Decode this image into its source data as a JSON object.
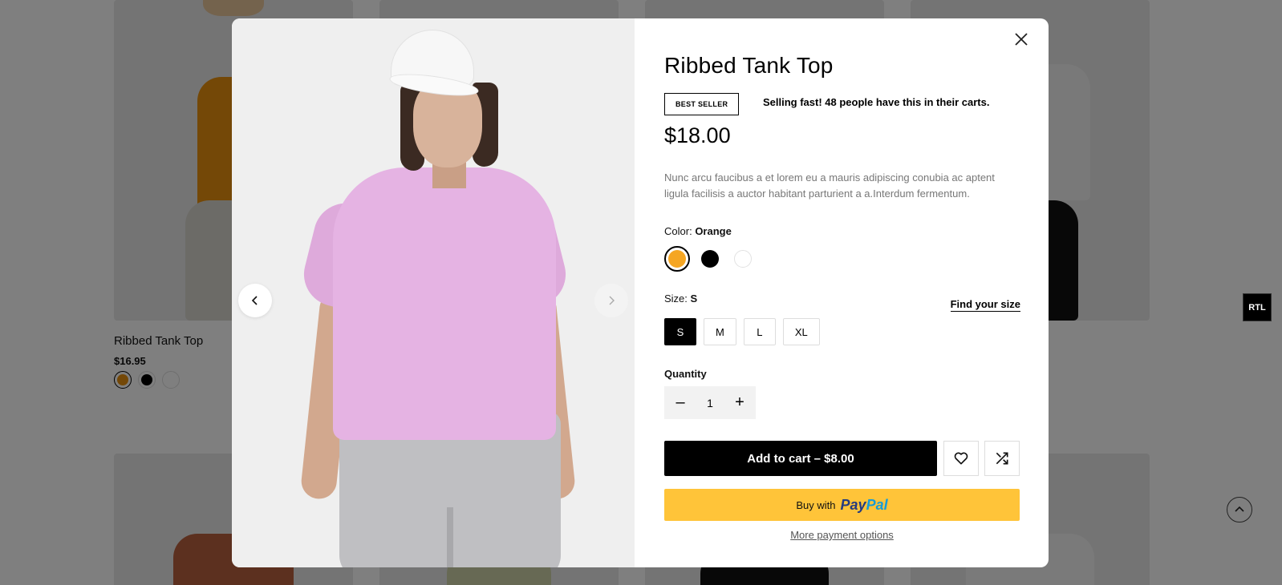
{
  "background_grid": {
    "cards": [
      {
        "title": "Ribbed Tank Top",
        "price": "$16.95",
        "swatches": [
          "#e8910e",
          "#000000",
          "#ffffff"
        ]
      }
    ]
  },
  "rtl_label": "RTL",
  "modal": {
    "product_title": "Ribbed Tank Top",
    "badge": "BEST SELLER",
    "selling_text": "Selling fast! 48 people have this in their carts.",
    "price": "$18.00",
    "description": "Nunc arcu faucibus a et lorem eu a mauris adipiscing conubia ac aptent ligula facilisis a auctor habitant parturient a a.Interdum fermentum.",
    "color": {
      "label": "Color:",
      "selected": "Orange",
      "options": [
        {
          "name": "Orange",
          "hex": "#f5a623"
        },
        {
          "name": "Black",
          "hex": "#000000"
        },
        {
          "name": "White",
          "hex": "#ffffff"
        }
      ]
    },
    "size": {
      "label": "Size:",
      "selected": "S",
      "find_size": "Find your size",
      "options": [
        "S",
        "M",
        "L",
        "XL"
      ]
    },
    "quantity": {
      "label": "Quantity",
      "value": "1",
      "minus": "–",
      "plus": "+"
    },
    "add_to_cart": "Add to cart – $8.00",
    "paypal": {
      "prefix": "Buy with",
      "logo_a": "Pay",
      "logo_b": "Pal"
    },
    "more_payment": "More payment options"
  },
  "colors": {
    "accent": "#000000",
    "paypal": "#ffc439",
    "muted_text": "#777777"
  }
}
